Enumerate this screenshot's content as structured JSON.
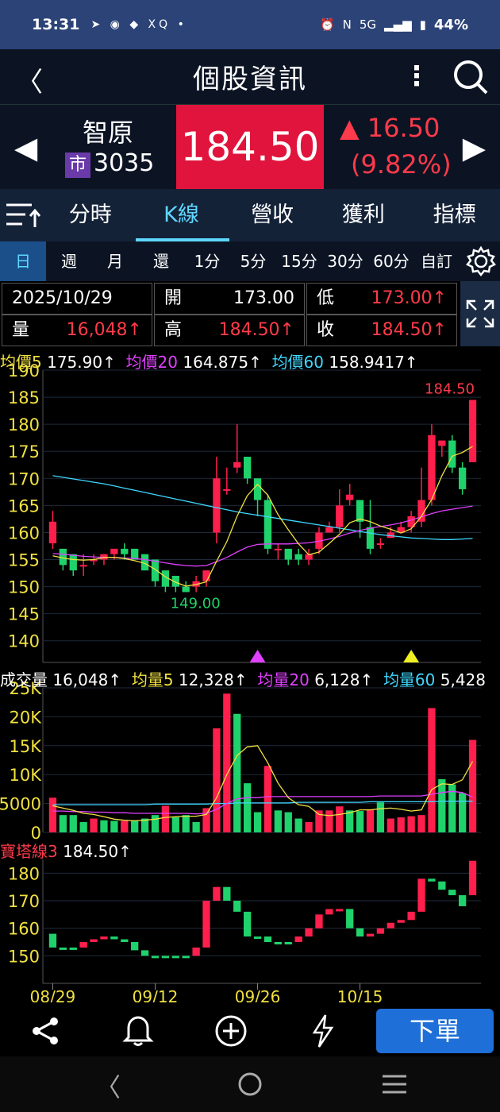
{
  "status_bar": {
    "time": "13:31",
    "battery": "44%",
    "network": "5G",
    "notification_icons": [
      "telegram-icon",
      "line-icon",
      "app-icon",
      "xq-icon",
      "dot-icon"
    ],
    "status_icons": [
      "alarm-icon",
      "nfc-icon",
      "volte-icon",
      "signal-icon",
      "signal-icon",
      "battery-icon"
    ]
  },
  "header": {
    "title": "個股資訊"
  },
  "stock": {
    "name": "智原",
    "market_badge": "市",
    "code": "3035",
    "price": "184.50",
    "change": "16.50",
    "change_pct": "(9.82%)",
    "up_color": "#ff3a4a",
    "price_bg": "#e0143c"
  },
  "tabs": [
    {
      "label": "分時",
      "active": false
    },
    {
      "label": "K線",
      "active": true
    },
    {
      "label": "營收",
      "active": false
    },
    {
      "label": "獲利",
      "active": false
    },
    {
      "label": "指標",
      "active": false
    }
  ],
  "periods": [
    {
      "label": "日",
      "active": true
    },
    {
      "label": "週"
    },
    {
      "label": "月"
    },
    {
      "label": "還"
    },
    {
      "label": "1分"
    },
    {
      "label": "5分"
    },
    {
      "label": "15分"
    },
    {
      "label": "30分"
    },
    {
      "label": "60分"
    },
    {
      "label": "自訂"
    }
  ],
  "info": {
    "date": "2025/10/29",
    "open_label": "開",
    "open": "173.00",
    "low_label": "低",
    "low": "173.00↑",
    "vol_label": "量",
    "volume": "16,048↑",
    "high_label": "高",
    "high": "184.50↑",
    "close_label": "收",
    "close": "184.50↑"
  },
  "ma_legend": {
    "ma5_label": "均價5",
    "ma5": "175.90↑",
    "ma20_label": "均價20",
    "ma20": "164.875↑",
    "ma60_label": "均價60",
    "ma60": "158.9417↑"
  },
  "vol_legend": {
    "label": "成交量",
    "vol": "16,048↑",
    "v5_label": "均量5",
    "v5": "12,328↑",
    "v20_label": "均量20",
    "v20": "6,128↑",
    "v60_label": "均量60",
    "v60": "5,428"
  },
  "bao_legend": {
    "label": "寶塔線3",
    "value": "184.50↑"
  },
  "bottom_nav": {
    "order_label": "下單"
  },
  "chart_data": [
    {
      "type": "candlestick",
      "title": "",
      "ylim": [
        136,
        190
      ],
      "y_ticks": [
        190,
        185,
        180,
        175,
        170,
        165,
        160,
        155,
        150,
        145,
        140
      ],
      "x_ticks": [
        "08/29",
        "09/12",
        "09/26",
        "10/15"
      ],
      "x_tick_index": [
        0,
        10,
        20,
        30
      ],
      "annotations": [
        {
          "text": "184.50",
          "index": 39,
          "value": 184.5
        },
        {
          "text": "149.00",
          "index": 13,
          "value": 149.0
        }
      ],
      "markers": [
        {
          "index": 20,
          "color": "#e040ff"
        },
        {
          "index": 35,
          "color": "#f0f020"
        }
      ],
      "candles": [
        [
          158,
          162,
          164,
          157
        ],
        [
          157,
          154,
          157,
          153
        ],
        [
          156,
          153,
          156,
          152
        ],
        [
          154,
          154,
          156,
          152
        ],
        [
          155,
          155,
          156,
          154
        ],
        [
          155,
          156,
          156,
          154
        ],
        [
          156,
          157,
          157,
          155
        ],
        [
          157,
          156,
          158,
          155
        ],
        [
          157,
          155,
          157,
          155
        ],
        [
          156,
          153,
          156,
          153
        ],
        [
          155,
          151,
          155,
          150
        ],
        [
          153,
          150,
          153,
          149
        ],
        [
          152,
          150,
          152,
          149
        ],
        [
          150,
          149,
          151,
          149
        ],
        [
          150,
          151,
          152,
          149
        ],
        [
          151,
          153,
          153,
          150
        ],
        [
          160,
          170,
          174,
          158
        ],
        [
          168,
          168,
          172,
          167
        ],
        [
          172,
          173,
          180,
          171
        ],
        [
          174,
          170,
          174,
          169
        ],
        [
          170,
          166,
          170,
          163
        ],
        [
          166,
          157,
          167,
          156
        ],
        [
          157,
          157,
          158,
          155
        ],
        [
          157,
          155,
          157,
          154
        ],
        [
          156,
          155,
          157,
          154
        ],
        [
          155,
          156,
          157,
          154
        ],
        [
          157,
          160,
          161,
          156
        ],
        [
          160,
          161,
          162,
          160
        ],
        [
          161,
          165,
          168,
          160
        ],
        [
          166,
          167,
          169,
          165
        ],
        [
          166,
          162,
          166,
          159
        ],
        [
          161,
          157,
          166,
          156
        ],
        [
          158,
          158,
          159,
          157
        ],
        [
          159,
          160,
          161,
          159
        ],
        [
          160,
          161,
          162,
          160
        ],
        [
          161,
          163,
          164,
          160
        ],
        [
          162,
          166,
          172,
          161
        ],
        [
          166,
          178,
          180,
          165
        ],
        [
          176,
          177,
          177,
          174
        ],
        [
          177,
          172,
          178,
          171
        ],
        [
          172,
          168,
          173,
          167
        ],
        [
          173,
          184.5,
          184.5,
          173
        ]
      ],
      "ma5": [
        155.7,
        155.3,
        155.0,
        154.9,
        155.0,
        155.4,
        155.4,
        155.2,
        154.8,
        154.3,
        153.2,
        151.8,
        150.8,
        150.1,
        150.4,
        150.9,
        154.7,
        158.3,
        163.0,
        166.8,
        168.9,
        166.9,
        163.3,
        160.5,
        157.9,
        155.9,
        156.4,
        158.0,
        159.7,
        161.8,
        162.5,
        162.0,
        161.2,
        160.6,
        159.9,
        160.7,
        163.0,
        166.1,
        170.5,
        174.1,
        174.8,
        175.9
      ],
      "ma20": [
        156.1,
        156.0,
        155.8,
        155.6,
        155.5,
        155.4,
        155.4,
        155.3,
        155.2,
        155.0,
        154.7,
        154.4,
        154.1,
        153.9,
        153.8,
        153.9,
        154.6,
        155.4,
        156.4,
        157.3,
        157.8,
        157.9,
        157.9,
        157.9,
        158.0,
        158.1,
        158.4,
        158.8,
        159.3,
        159.9,
        160.4,
        160.8,
        161.1,
        161.4,
        161.8,
        162.3,
        162.9,
        163.5,
        164.0,
        164.3,
        164.6,
        164.9
      ],
      "ma60": [
        170.5,
        170.2,
        169.9,
        169.6,
        169.3,
        169.0,
        168.6,
        168.2,
        167.8,
        167.4,
        167.0,
        166.6,
        166.2,
        165.8,
        165.4,
        165.0,
        164.6,
        164.2,
        163.8,
        163.5,
        163.2,
        162.9,
        162.6,
        162.3,
        162.0,
        161.7,
        161.4,
        161.1,
        160.8,
        160.5,
        160.2,
        159.9,
        159.6,
        159.4,
        159.2,
        159.0,
        158.9,
        158.8,
        158.7,
        158.7,
        158.8,
        158.9
      ]
    },
    {
      "type": "bar",
      "title": "",
      "ylim": [
        0,
        25000
      ],
      "y_ticks": [
        25000,
        20000,
        15000,
        10000,
        5000,
        0
      ],
      "y_tick_labels": [
        "25K",
        "20K",
        "15K",
        "10K",
        "5000",
        "0"
      ],
      "values": [
        6000,
        3000,
        3000,
        1800,
        2400,
        2100,
        2000,
        2000,
        2100,
        2400,
        3000,
        4600,
        2600,
        3000,
        1800,
        4200,
        18000,
        24000,
        20500,
        8500,
        3500,
        11500,
        3800,
        3500,
        2400,
        1800,
        3800,
        3800,
        4500,
        3800,
        3700,
        4000,
        5200,
        2400,
        2600,
        2800,
        3000,
        21500,
        9200,
        8300,
        6800,
        16000
      ],
      "up": [
        true,
        false,
        false,
        false,
        true,
        false,
        false,
        true,
        false,
        false,
        false,
        true,
        false,
        false,
        false,
        true,
        true,
        true,
        false,
        false,
        false,
        true,
        false,
        false,
        false,
        true,
        true,
        true,
        true,
        false,
        false,
        true,
        false,
        true,
        true,
        true,
        true,
        true,
        false,
        false,
        false,
        true
      ],
      "v5": [
        4600,
        4200,
        3800,
        3300,
        3100,
        2700,
        2300,
        2100,
        2000,
        2100,
        2300,
        2600,
        2700,
        2800,
        2800,
        3100,
        6000,
        10000,
        13300,
        14800,
        15000,
        12000,
        8500,
        6000,
        4800,
        4500,
        3100,
        2900,
        3100,
        3400,
        3900,
        3900,
        4100,
        4200,
        4000,
        3700,
        3900,
        7400,
        8400,
        8300,
        9100,
        12300
      ],
      "v20": [
        3700,
        3700,
        3600,
        3600,
        3500,
        3500,
        3400,
        3400,
        3300,
        3300,
        3300,
        3300,
        3300,
        3300,
        3200,
        3300,
        4000,
        5000,
        5800,
        6000,
        6000,
        6200,
        6200,
        6200,
        6200,
        6200,
        6200,
        6200,
        6200,
        6200,
        6200,
        6200,
        6300,
        6300,
        6300,
        6300,
        6300,
        6600,
        6900,
        7100,
        6900,
        6100
      ],
      "v60": [
        4800,
        4800,
        4800,
        4800,
        4800,
        4800,
        4800,
        4800,
        4800,
        4800,
        4900,
        4900,
        4900,
        4900,
        4900,
        4900,
        5000,
        5000,
        5100,
        5100,
        5100,
        5100,
        5100,
        5100,
        5200,
        5200,
        5200,
        5200,
        5200,
        5200,
        5200,
        5300,
        5300,
        5300,
        5300,
        5300,
        5300,
        5300,
        5400,
        5400,
        5400,
        5400
      ]
    },
    {
      "type": "bar",
      "title": "",
      "ylim": [
        140,
        185
      ],
      "y_ticks": [
        180,
        170,
        160,
        150
      ],
      "bricks": [
        [
          158,
          153,
          false
        ],
        [
          153,
          153,
          false
        ],
        [
          153,
          153,
          false
        ],
        [
          153,
          155,
          true
        ],
        [
          155,
          156,
          true
        ],
        [
          156,
          157,
          true
        ],
        [
          157,
          156,
          false
        ],
        [
          156,
          155,
          false
        ],
        [
          155,
          152,
          false
        ],
        [
          152,
          150,
          false
        ],
        [
          150,
          150,
          false
        ],
        [
          150,
          150,
          false
        ],
        [
          150,
          150,
          false
        ],
        [
          150,
          150,
          false
        ],
        [
          150,
          153,
          true
        ],
        [
          153,
          170,
          true
        ],
        [
          170,
          175,
          true
        ],
        [
          175,
          170,
          false
        ],
        [
          170,
          166,
          false
        ],
        [
          166,
          157,
          false
        ],
        [
          157,
          157,
          false
        ],
        [
          157,
          155,
          false
        ],
        [
          155,
          155,
          false
        ],
        [
          155,
          155,
          false
        ],
        [
          155,
          157,
          true
        ],
        [
          157,
          160,
          true
        ],
        [
          160,
          165,
          true
        ],
        [
          165,
          167,
          true
        ],
        [
          167,
          167,
          true
        ],
        [
          167,
          160,
          false
        ],
        [
          160,
          157,
          false
        ],
        [
          157,
          158,
          true
        ],
        [
          158,
          160,
          true
        ],
        [
          160,
          162,
          true
        ],
        [
          162,
          163,
          true
        ],
        [
          163,
          166,
          true
        ],
        [
          166,
          178,
          true
        ],
        [
          178,
          177,
          false
        ],
        [
          177,
          174,
          false
        ],
        [
          174,
          172,
          false
        ],
        [
          172,
          168,
          false
        ],
        [
          172,
          184.5,
          true
        ]
      ]
    }
  ]
}
